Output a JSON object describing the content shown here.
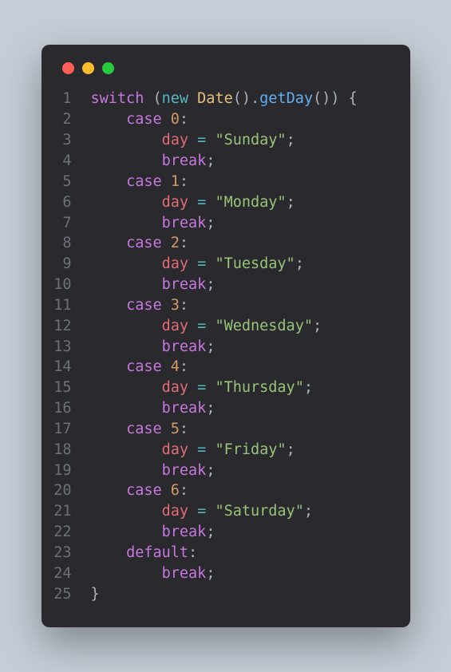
{
  "traffic_lights": {
    "red": "#ff5f56",
    "yellow": "#ffbd2e",
    "green": "#27c93f"
  },
  "code": {
    "lines": [
      {
        "num": "1",
        "tokens": [
          {
            "c": "kw",
            "t": "switch"
          },
          {
            "c": "plain",
            "t": " ("
          },
          {
            "c": "kw2",
            "t": "new"
          },
          {
            "c": "plain",
            "t": " "
          },
          {
            "c": "cls",
            "t": "Date"
          },
          {
            "c": "plain",
            "t": "()."
          },
          {
            "c": "fn",
            "t": "getDay"
          },
          {
            "c": "plain",
            "t": "()) {"
          }
        ]
      },
      {
        "num": "2",
        "tokens": [
          {
            "c": "plain",
            "t": "    "
          },
          {
            "c": "kw",
            "t": "case"
          },
          {
            "c": "plain",
            "t": " "
          },
          {
            "c": "num",
            "t": "0"
          },
          {
            "c": "plain",
            "t": ":"
          }
        ]
      },
      {
        "num": "3",
        "tokens": [
          {
            "c": "plain",
            "t": "        "
          },
          {
            "c": "var",
            "t": "day"
          },
          {
            "c": "plain",
            "t": " "
          },
          {
            "c": "op",
            "t": "="
          },
          {
            "c": "plain",
            "t": " "
          },
          {
            "c": "str",
            "t": "\"Sunday\""
          },
          {
            "c": "plain",
            "t": ";"
          }
        ]
      },
      {
        "num": "4",
        "tokens": [
          {
            "c": "plain",
            "t": "        "
          },
          {
            "c": "kw",
            "t": "break"
          },
          {
            "c": "plain",
            "t": ";"
          }
        ]
      },
      {
        "num": "5",
        "tokens": [
          {
            "c": "plain",
            "t": "    "
          },
          {
            "c": "kw",
            "t": "case"
          },
          {
            "c": "plain",
            "t": " "
          },
          {
            "c": "num",
            "t": "1"
          },
          {
            "c": "plain",
            "t": ":"
          }
        ]
      },
      {
        "num": "6",
        "tokens": [
          {
            "c": "plain",
            "t": "        "
          },
          {
            "c": "var",
            "t": "day"
          },
          {
            "c": "plain",
            "t": " "
          },
          {
            "c": "op",
            "t": "="
          },
          {
            "c": "plain",
            "t": " "
          },
          {
            "c": "str",
            "t": "\"Monday\""
          },
          {
            "c": "plain",
            "t": ";"
          }
        ]
      },
      {
        "num": "7",
        "tokens": [
          {
            "c": "plain",
            "t": "        "
          },
          {
            "c": "kw",
            "t": "break"
          },
          {
            "c": "plain",
            "t": ";"
          }
        ]
      },
      {
        "num": "8",
        "tokens": [
          {
            "c": "plain",
            "t": "    "
          },
          {
            "c": "kw",
            "t": "case"
          },
          {
            "c": "plain",
            "t": " "
          },
          {
            "c": "num",
            "t": "2"
          },
          {
            "c": "plain",
            "t": ":"
          }
        ]
      },
      {
        "num": "9",
        "tokens": [
          {
            "c": "plain",
            "t": "        "
          },
          {
            "c": "var",
            "t": "day"
          },
          {
            "c": "plain",
            "t": " "
          },
          {
            "c": "op",
            "t": "="
          },
          {
            "c": "plain",
            "t": " "
          },
          {
            "c": "str",
            "t": "\"Tuesday\""
          },
          {
            "c": "plain",
            "t": ";"
          }
        ]
      },
      {
        "num": "10",
        "tokens": [
          {
            "c": "plain",
            "t": "        "
          },
          {
            "c": "kw",
            "t": "break"
          },
          {
            "c": "plain",
            "t": ";"
          }
        ]
      },
      {
        "num": "11",
        "tokens": [
          {
            "c": "plain",
            "t": "    "
          },
          {
            "c": "kw",
            "t": "case"
          },
          {
            "c": "plain",
            "t": " "
          },
          {
            "c": "num",
            "t": "3"
          },
          {
            "c": "plain",
            "t": ":"
          }
        ]
      },
      {
        "num": "12",
        "tokens": [
          {
            "c": "plain",
            "t": "        "
          },
          {
            "c": "var",
            "t": "day"
          },
          {
            "c": "plain",
            "t": " "
          },
          {
            "c": "op",
            "t": "="
          },
          {
            "c": "plain",
            "t": " "
          },
          {
            "c": "str",
            "t": "\"Wednesday\""
          },
          {
            "c": "plain",
            "t": ";"
          }
        ]
      },
      {
        "num": "13",
        "tokens": [
          {
            "c": "plain",
            "t": "        "
          },
          {
            "c": "kw",
            "t": "break"
          },
          {
            "c": "plain",
            "t": ";"
          }
        ]
      },
      {
        "num": "14",
        "tokens": [
          {
            "c": "plain",
            "t": "    "
          },
          {
            "c": "kw",
            "t": "case"
          },
          {
            "c": "plain",
            "t": " "
          },
          {
            "c": "num",
            "t": "4"
          },
          {
            "c": "plain",
            "t": ":"
          }
        ]
      },
      {
        "num": "15",
        "tokens": [
          {
            "c": "plain",
            "t": "        "
          },
          {
            "c": "var",
            "t": "day"
          },
          {
            "c": "plain",
            "t": " "
          },
          {
            "c": "op",
            "t": "="
          },
          {
            "c": "plain",
            "t": " "
          },
          {
            "c": "str",
            "t": "\"Thursday\""
          },
          {
            "c": "plain",
            "t": ";"
          }
        ]
      },
      {
        "num": "16",
        "tokens": [
          {
            "c": "plain",
            "t": "        "
          },
          {
            "c": "kw",
            "t": "break"
          },
          {
            "c": "plain",
            "t": ";"
          }
        ]
      },
      {
        "num": "17",
        "tokens": [
          {
            "c": "plain",
            "t": "    "
          },
          {
            "c": "kw",
            "t": "case"
          },
          {
            "c": "plain",
            "t": " "
          },
          {
            "c": "num",
            "t": "5"
          },
          {
            "c": "plain",
            "t": ":"
          }
        ]
      },
      {
        "num": "18",
        "tokens": [
          {
            "c": "plain",
            "t": "        "
          },
          {
            "c": "var",
            "t": "day"
          },
          {
            "c": "plain",
            "t": " "
          },
          {
            "c": "op",
            "t": "="
          },
          {
            "c": "plain",
            "t": " "
          },
          {
            "c": "str",
            "t": "\"Friday\""
          },
          {
            "c": "plain",
            "t": ";"
          }
        ]
      },
      {
        "num": "19",
        "tokens": [
          {
            "c": "plain",
            "t": "        "
          },
          {
            "c": "kw",
            "t": "break"
          },
          {
            "c": "plain",
            "t": ";"
          }
        ]
      },
      {
        "num": "20",
        "tokens": [
          {
            "c": "plain",
            "t": "    "
          },
          {
            "c": "kw",
            "t": "case"
          },
          {
            "c": "plain",
            "t": " "
          },
          {
            "c": "num",
            "t": "6"
          },
          {
            "c": "plain",
            "t": ":"
          }
        ]
      },
      {
        "num": "21",
        "tokens": [
          {
            "c": "plain",
            "t": "        "
          },
          {
            "c": "var",
            "t": "day"
          },
          {
            "c": "plain",
            "t": " "
          },
          {
            "c": "op",
            "t": "="
          },
          {
            "c": "plain",
            "t": " "
          },
          {
            "c": "str",
            "t": "\"Saturday\""
          },
          {
            "c": "plain",
            "t": ";"
          }
        ]
      },
      {
        "num": "22",
        "tokens": [
          {
            "c": "plain",
            "t": "        "
          },
          {
            "c": "kw",
            "t": "break"
          },
          {
            "c": "plain",
            "t": ";"
          }
        ]
      },
      {
        "num": "23",
        "tokens": [
          {
            "c": "plain",
            "t": "    "
          },
          {
            "c": "kw",
            "t": "default"
          },
          {
            "c": "plain",
            "t": ":"
          }
        ]
      },
      {
        "num": "24",
        "tokens": [
          {
            "c": "plain",
            "t": "        "
          },
          {
            "c": "kw",
            "t": "break"
          },
          {
            "c": "plain",
            "t": ";"
          }
        ]
      },
      {
        "num": "25",
        "tokens": [
          {
            "c": "plain",
            "t": "}"
          }
        ]
      }
    ]
  }
}
